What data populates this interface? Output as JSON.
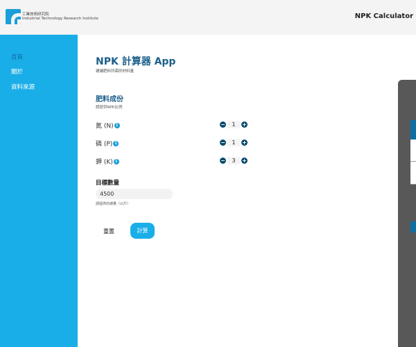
{
  "header": {
    "org_cn": "工業技術研究院",
    "org_en": "Industrial Technology Research Institute",
    "app_title": "NPK Calculator"
  },
  "sidebar": {
    "items": [
      {
        "label": "首頁",
        "active": true
      },
      {
        "label": "關於",
        "active": false
      },
      {
        "label": "資料來源",
        "active": false
      }
    ]
  },
  "main": {
    "title": "NPK 計算器 App",
    "subtitle": "建議肥料所需的材料量",
    "section_title": "肥料成份",
    "section_sub": "請提供NPK比例",
    "nutrients": [
      {
        "label": "氮 (N)",
        "value": "1"
      },
      {
        "label": "磷 (P)",
        "value": "1"
      },
      {
        "label": "鉀 (K)",
        "value": "3"
      }
    ],
    "target_label": "目標數量",
    "target_value": "4500",
    "target_hint": "請提供的總量（公斤）",
    "reset_label": "重置",
    "calculate_label": "計算"
  },
  "icons": {
    "info": "info-icon",
    "minus": "minus-icon",
    "plus": "plus-icon"
  },
  "colors": {
    "accent": "#1aaee8",
    "title": "#1d5f8a",
    "stepper": "#0a4a6e"
  }
}
